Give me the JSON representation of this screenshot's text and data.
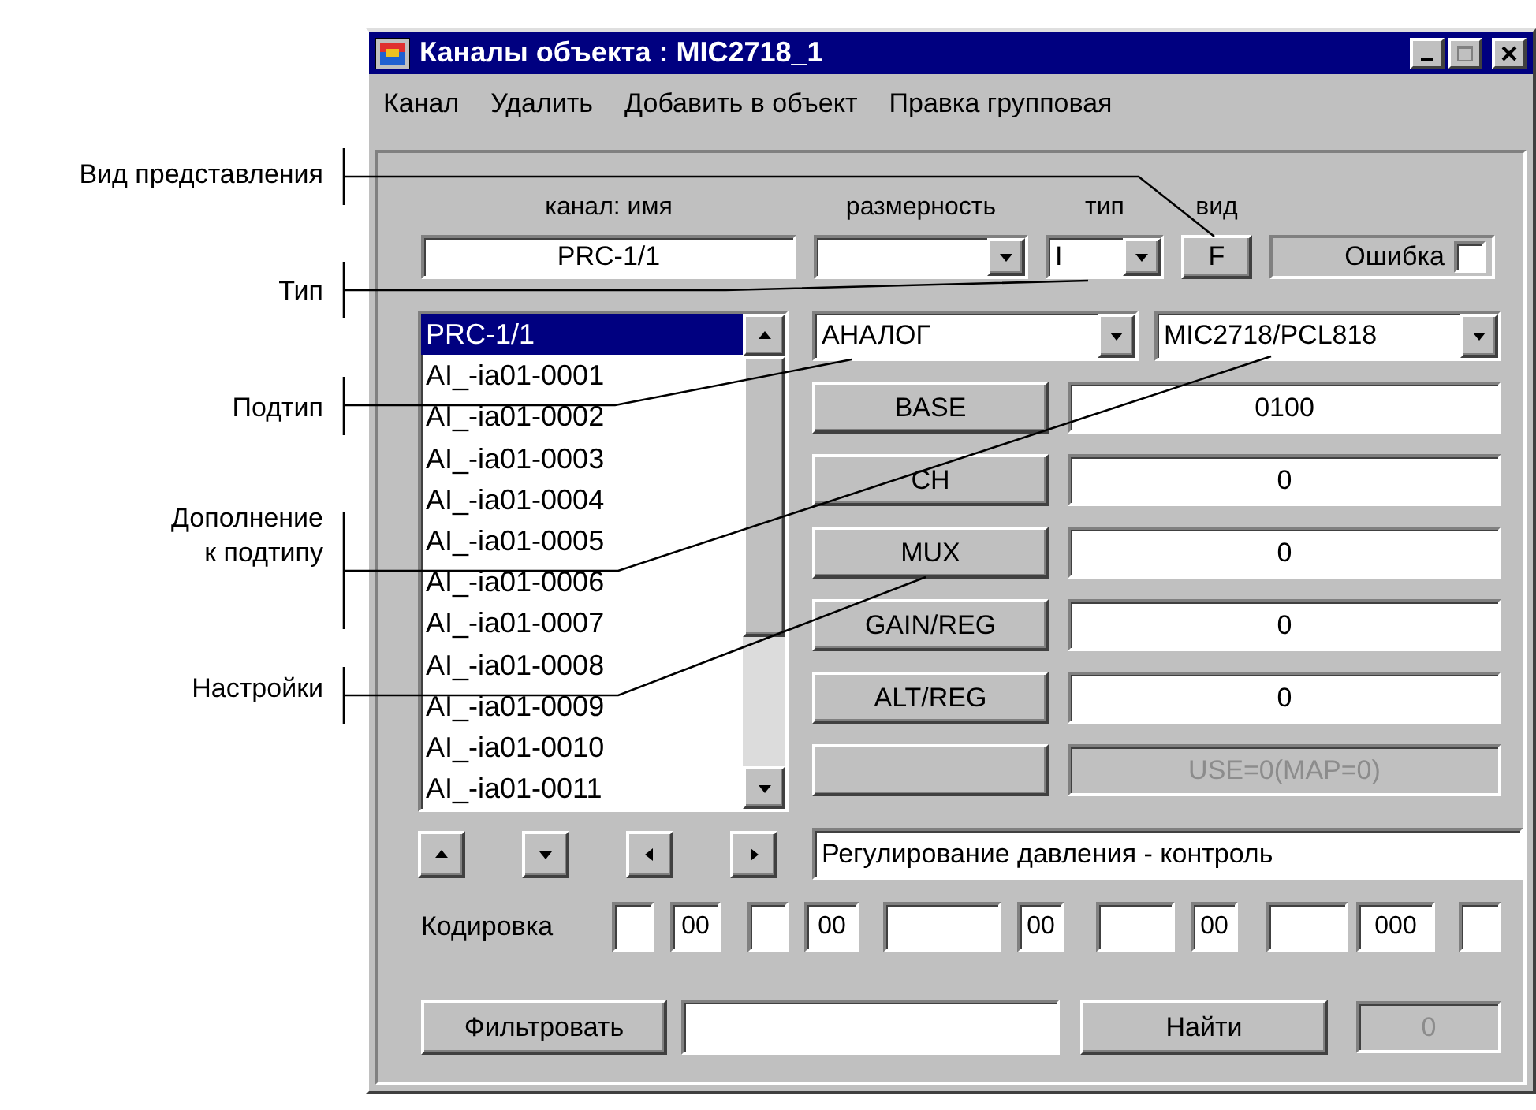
{
  "annotations": [
    {
      "text": "Вид представления"
    },
    {
      "text": "Тип"
    },
    {
      "text": "Подтип"
    },
    {
      "text": "Дополнение к подтипу"
    },
    {
      "text": "Настройки"
    }
  ],
  "window": {
    "title": "Каналы объекта : MIC2718_1"
  },
  "menu": [
    "Канал",
    "Удалить",
    "Добавить в объект",
    "Правка групповая"
  ],
  "header_labels": [
    "канал: имя",
    "размерность",
    "тип",
    "вид"
  ],
  "name_field": {
    "value": "PRC-1/1"
  },
  "type_combo": {
    "value": "I"
  },
  "view_button": "F",
  "error_checkbox": {
    "label": "Ошибка",
    "checked": false
  },
  "channel_list": {
    "items": [
      {
        "label": "PRC-1/1",
        "selected": true
      },
      {
        "label": "AI_-ia01-0001",
        "selected": false
      },
      {
        "label": "AI_-ia01-0002",
        "selected": false
      },
      {
        "label": "AI_-ia01-0003",
        "selected": false
      },
      {
        "label": "AI_-ia01-0004",
        "selected": false
      },
      {
        "label": "AI_-ia01-0005",
        "selected": false
      },
      {
        "label": "AI_-ia01-0006",
        "selected": false
      },
      {
        "label": "AI_-ia01-0007",
        "selected": false
      },
      {
        "label": "AI_-ia01-0008",
        "selected": false
      },
      {
        "label": "AI_-ia01-0009",
        "selected": false
      },
      {
        "label": "AI_-ia01-0010",
        "selected": false
      },
      {
        "label": "AI_-ia01-0011",
        "selected": false
      }
    ]
  },
  "subtype_combo": {
    "value": "АНАЛОГ"
  },
  "subtype_addition_combo": {
    "value": "MIC2718/PCL818"
  },
  "settings": [
    {
      "button": "BASE",
      "value": "0100",
      "disabled": false
    },
    {
      "button": "CH",
      "value": "0",
      "disabled": false
    },
    {
      "button": "MUX",
      "value": "0",
      "disabled": false
    },
    {
      "button": "GAIN/REG",
      "value": "0",
      "disabled": false
    },
    {
      "button": "ALT/REG",
      "value": "0",
      "disabled": false
    },
    {
      "value": "USE=0(MAP=0)",
      "disabled": true
    }
  ],
  "description": {
    "value": "Регулирование давления - контроль"
  },
  "encoding": {
    "label": "Кодировка",
    "values": [
      "00",
      "00",
      "00",
      "00",
      "000"
    ]
  },
  "filter_button": "Фильтровать",
  "find_button": "Найти",
  "found_count": {
    "value": "0",
    "disabled": true
  }
}
